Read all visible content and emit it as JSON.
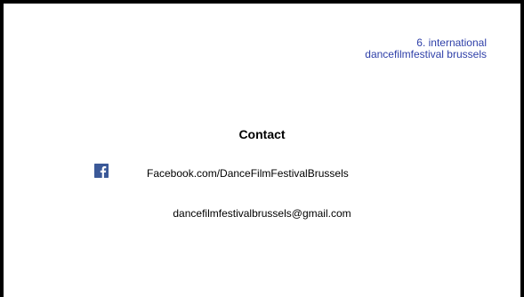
{
  "header": {
    "title_line1": "6. international",
    "title_line2": "dancefilmfestival brussels"
  },
  "contact": {
    "heading": "Contact",
    "facebook_icon": "facebook-icon",
    "facebook_text": "Facebook.com/DanceFilmFestivalBrussels",
    "email_text": "dancefilmfestivalbrussels@gmail.com"
  },
  "colors": {
    "title": "#2e3fa8",
    "facebook": "#3b5998",
    "border": "#000000"
  }
}
